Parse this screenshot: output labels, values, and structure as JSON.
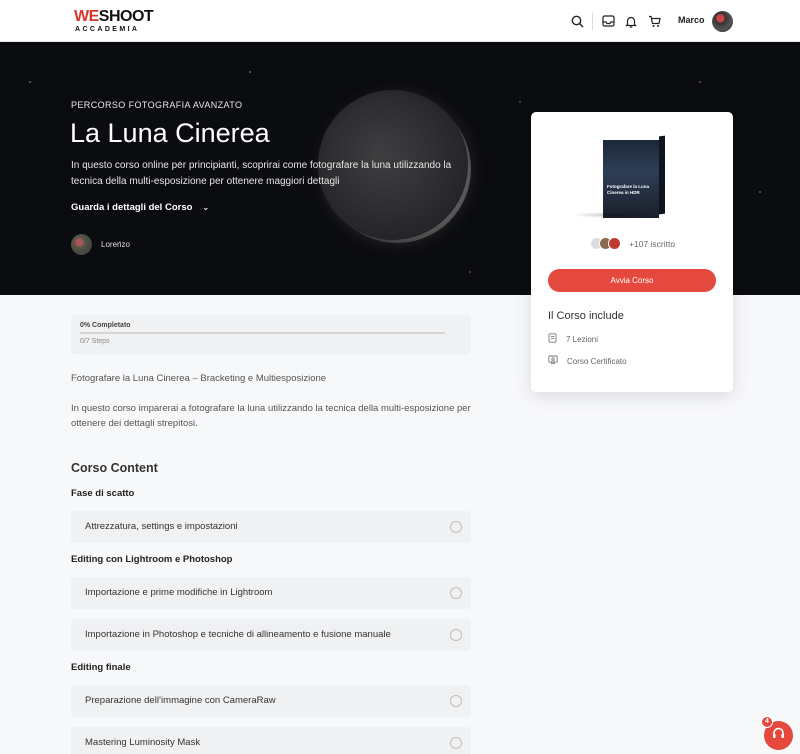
{
  "header": {
    "logo_we": "WE",
    "logo_shoot": "SHOOT",
    "logo_sub": "ACCADEMIA",
    "user_name": "Marco",
    "icons": [
      "search-icon",
      "inbox-icon",
      "bell-icon",
      "cart-icon"
    ]
  },
  "hero": {
    "eyebrow": "PERCORSO FOTOGRAFIA AVANZATO",
    "title": "La Luna Cinerea",
    "description": "In questo corso online per principianti, scoprirai come fotografare la luna utilizzando la tecnica della multi-esposizione per ottenere maggiori dettagli",
    "details_link": "Guarda i dettagli del Corso",
    "author": "Lorenzo"
  },
  "card": {
    "box_title": "Fotografare la Luna Cinerea in HDR",
    "enrolled": "+107 iscritto",
    "start_button": "Avvia Corso",
    "includes_title": "Il Corso include",
    "includes": [
      {
        "icon": "document-icon",
        "label": "7 Lezioni"
      },
      {
        "icon": "certificate-icon",
        "label": "Corso Certificato"
      }
    ]
  },
  "progress": {
    "label": "0% Completato",
    "steps": "0/7 Steps",
    "percent": 0
  },
  "content": {
    "intro": "Fotografare la Luna Cinerea – Bracketing e Multiesposizione",
    "body": "In questo corso imparerai a fotografare la luna utilizzando la tecnica della multi-esposizione per ottenere dei dettagli strepitosi.",
    "section_title": "Corso Content",
    "groups": [
      {
        "title": "Fase di scatto",
        "lessons": [
          "Attrezzatura, settings e impostazioni"
        ]
      },
      {
        "title": "Editing con Lightroom e Photoshop",
        "lessons": [
          "Importazione e prime modifiche in Lightroom",
          "Importazione in Photoshop e tecniche di allineamento e fusione manuale"
        ]
      },
      {
        "title": "Editing finale",
        "lessons": [
          "Preparazione dell’immagine con CameraRaw",
          "Mastering Luminosity Mask"
        ]
      }
    ]
  },
  "chat": {
    "badge": "4",
    "color": "#e5493e"
  }
}
